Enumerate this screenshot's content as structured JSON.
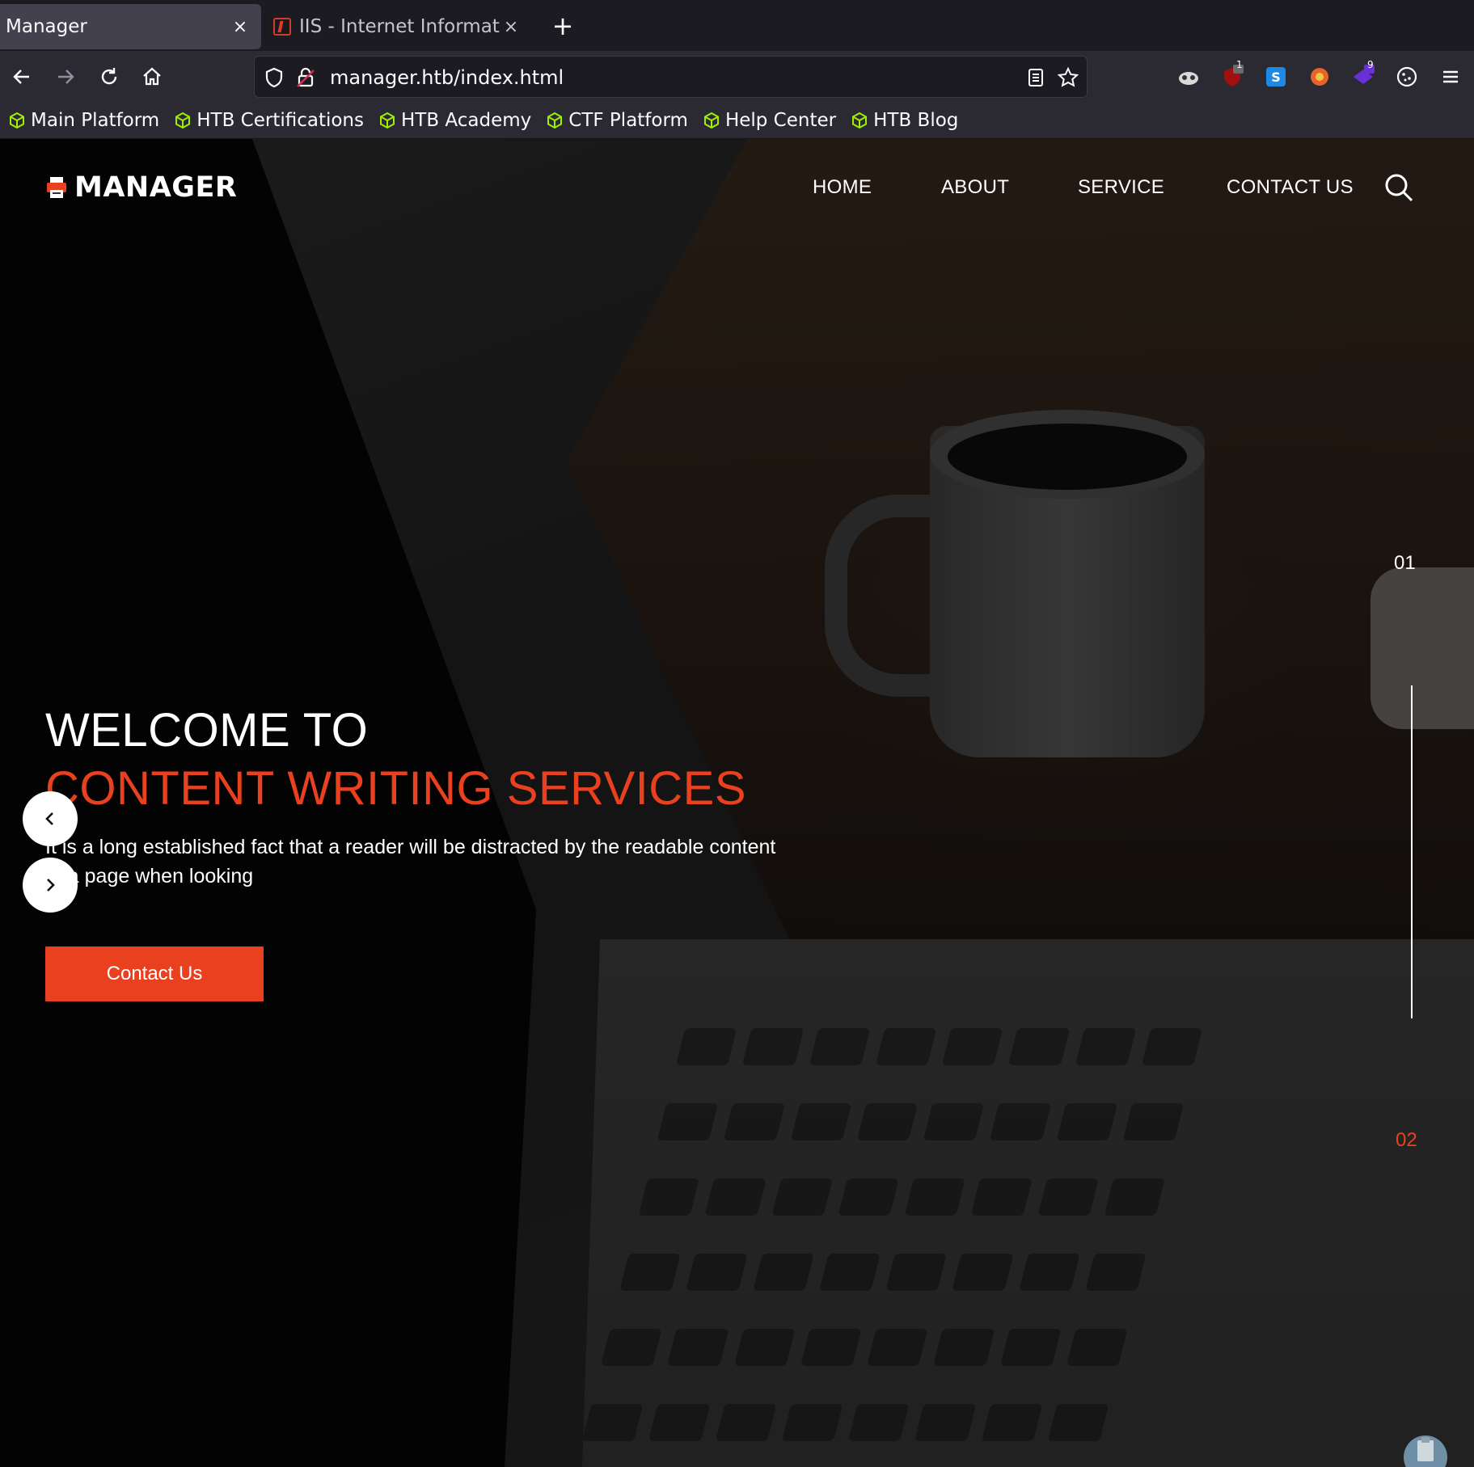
{
  "browser": {
    "tabs": [
      {
        "title": "Manager",
        "close": "×",
        "active": true
      },
      {
        "title": "IIS - Internet Information",
        "close": "×",
        "active": false
      }
    ],
    "new_tab": "+",
    "url": "manager.htb/index.html",
    "bookmarks": [
      "Main Platform",
      "HTB Certifications",
      "HTB Academy",
      "CTF Platform",
      "Help Center",
      "HTB Blog"
    ],
    "extension_badges": {
      "ublock": "1",
      "extension_purple": "9"
    }
  },
  "site": {
    "logo": "MANAGER",
    "menu": [
      "HOME",
      "ABOUT",
      "SERVICE",
      "CONTACT US"
    ],
    "hero": {
      "line1": "WELCOME TO",
      "line2": "CONTENT WRITING SERVICES",
      "description": "It is a long established fact that a reader will be distracted by the readable content of a page when looking",
      "cta": "Contact Us"
    },
    "slides": {
      "current": "01",
      "next": "02"
    }
  },
  "colors": {
    "accent": "#e9401f",
    "tab_bg": "#1c1b22",
    "toolbar_bg": "#2b2a33",
    "bookmark_icon": "#9fef00"
  },
  "icons": [
    "back-icon",
    "forward-icon",
    "reload-icon",
    "home-icon",
    "shield-icon",
    "lock-icon",
    "reader-mode-icon",
    "star-icon",
    "search-icon",
    "chevron-left-icon",
    "chevron-right-icon",
    "menu-icon"
  ]
}
